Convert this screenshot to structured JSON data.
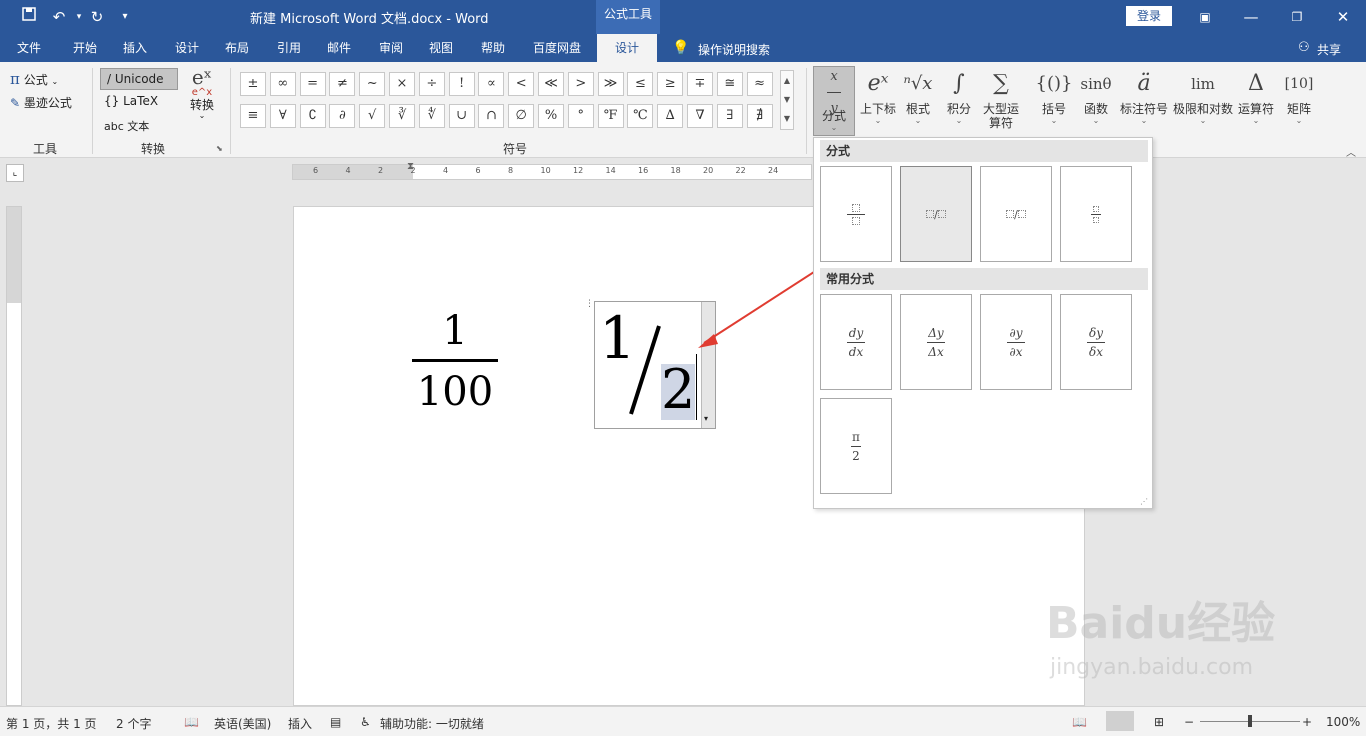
{
  "titlebar": {
    "title": "新建 Microsoft Word 文档.docx  -  Word",
    "context_tab": "公式工具",
    "login_label": "登录"
  },
  "tabs": [
    "文件",
    "开始",
    "插入",
    "设计",
    "布局",
    "引用",
    "邮件",
    "审阅",
    "视图",
    "帮助",
    "百度网盘",
    "设计"
  ],
  "tell_me": "操作说明搜索",
  "share_label": "共享",
  "ribbon": {
    "tools": {
      "equation_label": "公式",
      "ink_label": "墨迹公式",
      "group_label": "工具"
    },
    "conversions": {
      "unicode_label": "Unicode",
      "latex_label": "LaTeX",
      "text_label": "abc 文本",
      "convert_label": "转换",
      "group_label": "转换"
    },
    "symbols": {
      "row1": [
        "±",
        "∞",
        "=",
        "≠",
        "~",
        "×",
        "÷",
        "!",
        "∝",
        "<",
        "≪",
        ">",
        "≫",
        "≤",
        "≥",
        "∓",
        "≅",
        "≈"
      ],
      "row2": [
        "≡",
        "∀",
        "∁",
        "∂",
        "√",
        "∛",
        "∜",
        "∪",
        "∩",
        "∅",
        "%",
        "°",
        "℉",
        "℃",
        "∆",
        "∇",
        "∃",
        "∄"
      ],
      "group_label": "符号"
    },
    "structures": [
      {
        "icon": "x/y",
        "label": "分式"
      },
      {
        "icon": "eˣ",
        "label": "上下标"
      },
      {
        "icon": "ⁿ√x",
        "label": "根式"
      },
      {
        "icon": "∫",
        "label": "积分"
      },
      {
        "icon": "∑",
        "label": "大型运算符"
      },
      {
        "icon": "{()}",
        "label": "括号"
      },
      {
        "icon": "sinθ",
        "label": "函数"
      },
      {
        "icon": "ä",
        "label": "标注符号"
      },
      {
        "icon": "lim",
        "label": "极限和对数"
      },
      {
        "icon": "Δ",
        "label": "运算符"
      },
      {
        "icon": "[10]",
        "label": "矩阵"
      }
    ]
  },
  "ruler": {
    "marks": [
      "6",
      "4",
      "2",
      "2",
      "4",
      "6",
      "8",
      "10",
      "12",
      "14",
      "16",
      "18",
      "20",
      "22",
      "24"
    ]
  },
  "document": {
    "eq1_num": "1",
    "eq1_den": "100",
    "eq2_num": "1",
    "eq2_den": "2"
  },
  "panel": {
    "section1": "分式",
    "section2": "常用分式",
    "common": [
      {
        "num": "dy",
        "den": "dx"
      },
      {
        "num": "Δy",
        "den": "Δx"
      },
      {
        "num": "∂y",
        "den": "∂x"
      },
      {
        "num": "δy",
        "den": "δx"
      },
      {
        "num": "π",
        "den": "2"
      }
    ]
  },
  "status": {
    "page": "第 1 页，共 1 页",
    "words": "2 个字",
    "language": "英语(美国)",
    "mode": "插入",
    "accessibility": "辅助功能: 一切就绪",
    "zoom": "100%"
  },
  "watermark": {
    "brand": "Baidu经验",
    "url": "jingyan.baidu.com"
  }
}
